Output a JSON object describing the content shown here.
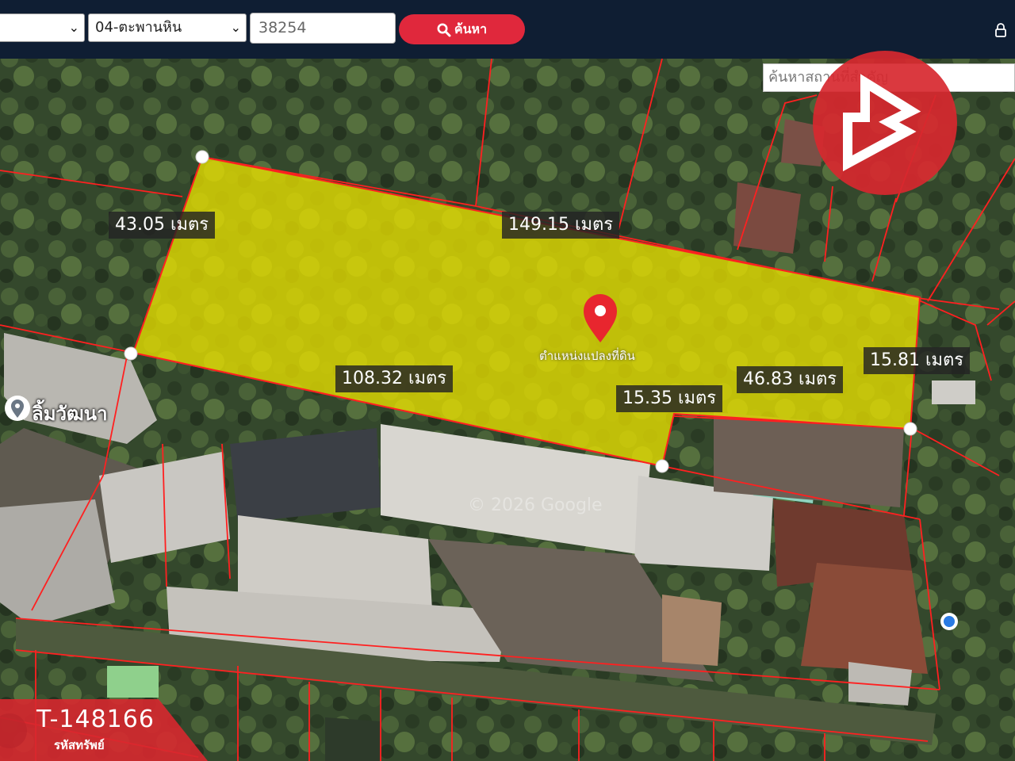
{
  "toolbar": {
    "district_value": "",
    "subdistrict_value": "04-ตะพานหิน",
    "parcel_input_value": "38254",
    "search_button_label": "ค้นหา"
  },
  "map": {
    "place_search_placeholder": "ค้นหาสถานที่สำคัญ",
    "pin_label": "ตำแหน่งแปลงที่ดิน",
    "place_label": "ลิ้มวัฒนา",
    "copyright": "© 2026 Google",
    "measurements": {
      "left": "43.05 เมตร",
      "top": "149.15 เมตร",
      "bottom_left": "108.32 เมตร",
      "bottom_step": "15.35 เมตร",
      "bottom_right": "46.83 เมตร",
      "right": "15.81 เมตร"
    }
  },
  "badge": {
    "code": "T-148166",
    "caption": "รหัสทรัพย์"
  },
  "colors": {
    "toolbar_bg": "#0f1e33",
    "search_button": "#e0283c",
    "parcel_fill": "#e8e000",
    "boundary": "#ff2020",
    "logo": "#d7282f"
  }
}
